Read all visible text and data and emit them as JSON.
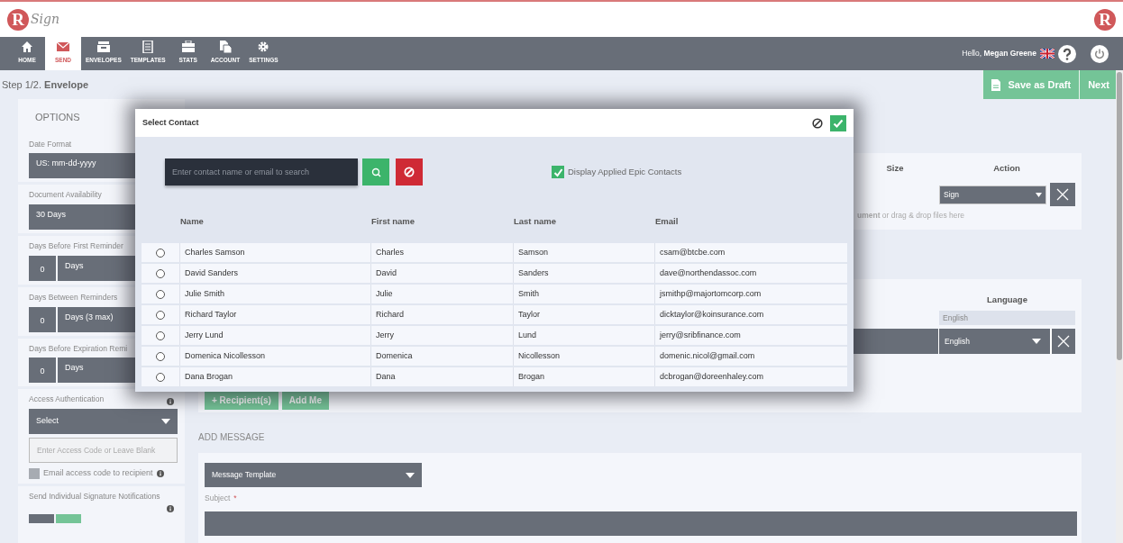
{
  "header": {
    "logo_letter": "R",
    "logo_word": "Sign",
    "corner_letter": "R"
  },
  "nav": [
    {
      "label": "HOME",
      "kind": "home",
      "selected": false
    },
    {
      "label": "SEND",
      "kind": "mail",
      "selected": true
    },
    {
      "label": "ENVELOPES",
      "kind": "box",
      "selected": false
    },
    {
      "label": "TEMPLATES",
      "kind": "doc",
      "selected": false
    },
    {
      "label": "STATS",
      "kind": "case",
      "selected": false
    },
    {
      "label": "ACCOUNT",
      "kind": "files",
      "selected": false
    },
    {
      "label": "SETTINGS",
      "kind": "gear",
      "selected": false
    }
  ],
  "user": {
    "greeting": "Hello, **Megan Greene**"
  },
  "step": "Step 1/2. **Envelope**",
  "actions": [
    {
      "label": "Save as Draft",
      "kind": "draft"
    },
    {
      "label": "Next",
      "kind": "next"
    }
  ],
  "options": {
    "title": "OPTIONS",
    "sections": [
      {
        "kind": "select",
        "label": "Date Format",
        "value": "US: mm-dd-yyyy"
      },
      {
        "kind": "select",
        "label": "Document Availability",
        "value": "30 Days"
      },
      {
        "kind": "number",
        "label": "Days Before First Reminder",
        "number": "0",
        "unit": "Days"
      },
      {
        "kind": "number",
        "label": "Days Between Reminders",
        "number": "0",
        "unit": "Days (3 max)"
      },
      {
        "kind": "number",
        "label": "Days Before Expiration Remi",
        "number": "0",
        "unit": "Days"
      },
      {
        "kind": "auth",
        "label": "Access Authentication",
        "value": "Select",
        "placeholder": "Enter Access Code or Leave Blank",
        "checkbox": {
          "label": "Email access code to recipient",
          "checked": false
        }
      },
      {
        "kind": "toggle",
        "label": "Send Individual Signature Notifications",
        "on": true
      }
    ]
  },
  "documents": {
    "columns": [
      "Size",
      "Action"
    ],
    "action_value": "Sign",
    "hint": "**ument** or drag & drop files here"
  },
  "recipients": {
    "columns": [
      "Language"
    ],
    "default_language": "English",
    "language_value": "English",
    "buttons": [
      "+ Recipient(s)",
      "Add Me"
    ]
  },
  "message": {
    "heading": "ADD MESSAGE",
    "template": "Message Template",
    "subject_label": "Subject",
    "required_mark": "*"
  },
  "dialog": {
    "title": "Select Contact",
    "search_placeholder": "Enter contact name or email to search",
    "filter": {
      "label": "Display Applied Epic Contacts",
      "checked": true
    },
    "columns": [
      "Name",
      "First name",
      "Last name",
      "Email"
    ],
    "rows": [
      {
        "name": "Charles Samson",
        "first": "Charles",
        "last": "Samson",
        "email": "csam@btcbe.com",
        "selected": false
      },
      {
        "name": "David Sanders",
        "first": "David",
        "last": "Sanders",
        "email": "dave@northendassoc.com",
        "selected": false
      },
      {
        "name": "Julie Smith",
        "first": "Julie",
        "last": "Smith",
        "email": "jsmithp@majortomcorp.com",
        "selected": false
      },
      {
        "name": "Richard Taylor",
        "first": "Richard",
        "last": "Taylor",
        "email": "dicktaylor@koinsurance.com",
        "selected": false
      },
      {
        "name": "Jerry Lund",
        "first": "Jerry",
        "last": "Lund",
        "email": "jerry@sribfinance.com",
        "selected": false
      },
      {
        "name": "Domenica Nicollesson",
        "first": "Domenica",
        "last": "Nicollesson",
        "email": "domenic.nicol@gmail.com",
        "selected": false
      },
      {
        "name": "Dana Brogan",
        "first": "Dana",
        "last": "Brogan",
        "email": "dcbrogan@doreenhaley.com",
        "selected": false
      }
    ]
  }
}
